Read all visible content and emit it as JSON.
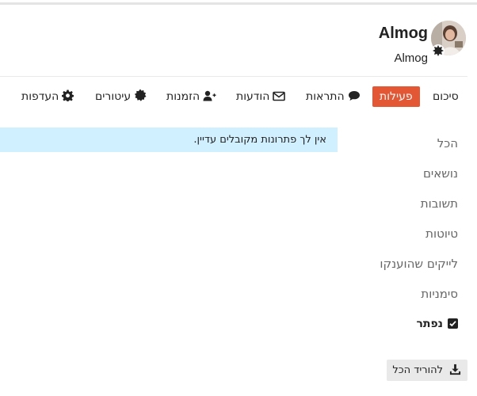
{
  "user": {
    "username": "Almog",
    "full_name": "Almog"
  },
  "nav": {
    "summary": "סיכום",
    "activity": "פעילות",
    "notifications": "התראות",
    "messages": "הודעות",
    "invites": "הזמנות",
    "badges": "עיטורים",
    "preferences": "העדפות"
  },
  "alert": {
    "text": "אין לך פתרונות מקובלים עדיין."
  },
  "sidebar": {
    "items": [
      {
        "label": "הכל"
      },
      {
        "label": "נושאים"
      },
      {
        "label": "תשובות"
      },
      {
        "label": "טיוטות"
      },
      {
        "label": "לייקים שהוענקו"
      },
      {
        "label": "סימניות"
      },
      {
        "label": "נפתר"
      }
    ]
  },
  "download": {
    "label": "להוריד הכל"
  },
  "colors": {
    "accent": "#e45735",
    "alert_bg": "#d1f0ff",
    "button_bg": "#e9e9e9"
  }
}
